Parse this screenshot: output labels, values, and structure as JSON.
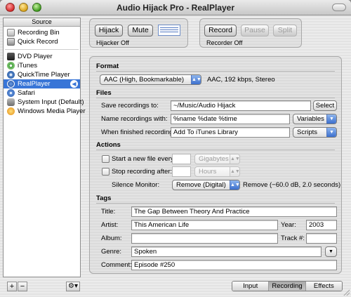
{
  "window": {
    "title": "Audio Hijack Pro - RealPlayer"
  },
  "source": {
    "header": "Source",
    "group1": [
      {
        "label": "Recording Bin",
        "icon": "recording-bin-icon"
      },
      {
        "label": "Quick Record",
        "icon": "quick-record-icon"
      }
    ],
    "group2": [
      {
        "label": "DVD Player",
        "icon": "dvd-player-icon"
      },
      {
        "label": "iTunes",
        "icon": "itunes-icon"
      },
      {
        "label": "QuickTime Player",
        "icon": "quicktime-icon"
      },
      {
        "label": "RealPlayer",
        "icon": "realplayer-icon",
        "selected": true
      },
      {
        "label": "Safari",
        "icon": "safari-icon"
      },
      {
        "label": "System Input (Default)",
        "icon": "system-input-icon"
      },
      {
        "label": "Windows Media Player",
        "icon": "windows-media-icon"
      }
    ],
    "add_label": "+",
    "remove_label": "−",
    "gear_label": "⚙▾"
  },
  "hijack": {
    "hijack_label": "Hijack",
    "mute_label": "Mute",
    "status": "Hijacker Off"
  },
  "recorder": {
    "record_label": "Record",
    "pause_label": "Pause",
    "split_label": "Split",
    "status": "Recorder Off"
  },
  "format": {
    "section": "Format",
    "preset": "AAC (High, Bookmarkable)",
    "summary": "AAC, 192 kbps, Stereo"
  },
  "files": {
    "section": "Files",
    "save_label": "Save recordings to:",
    "save_path": "~/Music/Audio Hijack",
    "select_label": "Select",
    "name_label": "Name recordings with:",
    "name_pattern": "%name %date %time",
    "variables_label": "Variables",
    "finished_label": "When finished recording:",
    "finished_action": "Add To iTunes Library",
    "scripts_label": "Scripts"
  },
  "actions": {
    "section": "Actions",
    "new_file_label": "Start a new file every:",
    "new_file_unit": "Gigabytes",
    "stop_label": "Stop recording after:",
    "stop_unit": "Hours",
    "silence_label": "Silence Monitor:",
    "silence_value": "Remove (Digital)",
    "silence_detail": "Remove (−60.0 dB, 2.0 seconds)"
  },
  "tags": {
    "section": "Tags",
    "title_label": "Title:",
    "title_value": "The Gap Between Theory And Practice",
    "artist_label": "Artist:",
    "artist_value": "This American Life",
    "year_label": "Year:",
    "year_value": "2003",
    "album_label": "Album:",
    "album_value": "",
    "track_label": "Track #:",
    "track_value": "",
    "genre_label": "Genre:",
    "genre_value": "Spoken",
    "comment_label": "Comment:",
    "comment_value": "Episode #250"
  },
  "tabs": {
    "input": "Input",
    "recording": "Recording",
    "effects": "Effects",
    "active": "Recording"
  },
  "colors": {
    "selection": "#3875d7",
    "accent": "#3b6fcd"
  }
}
